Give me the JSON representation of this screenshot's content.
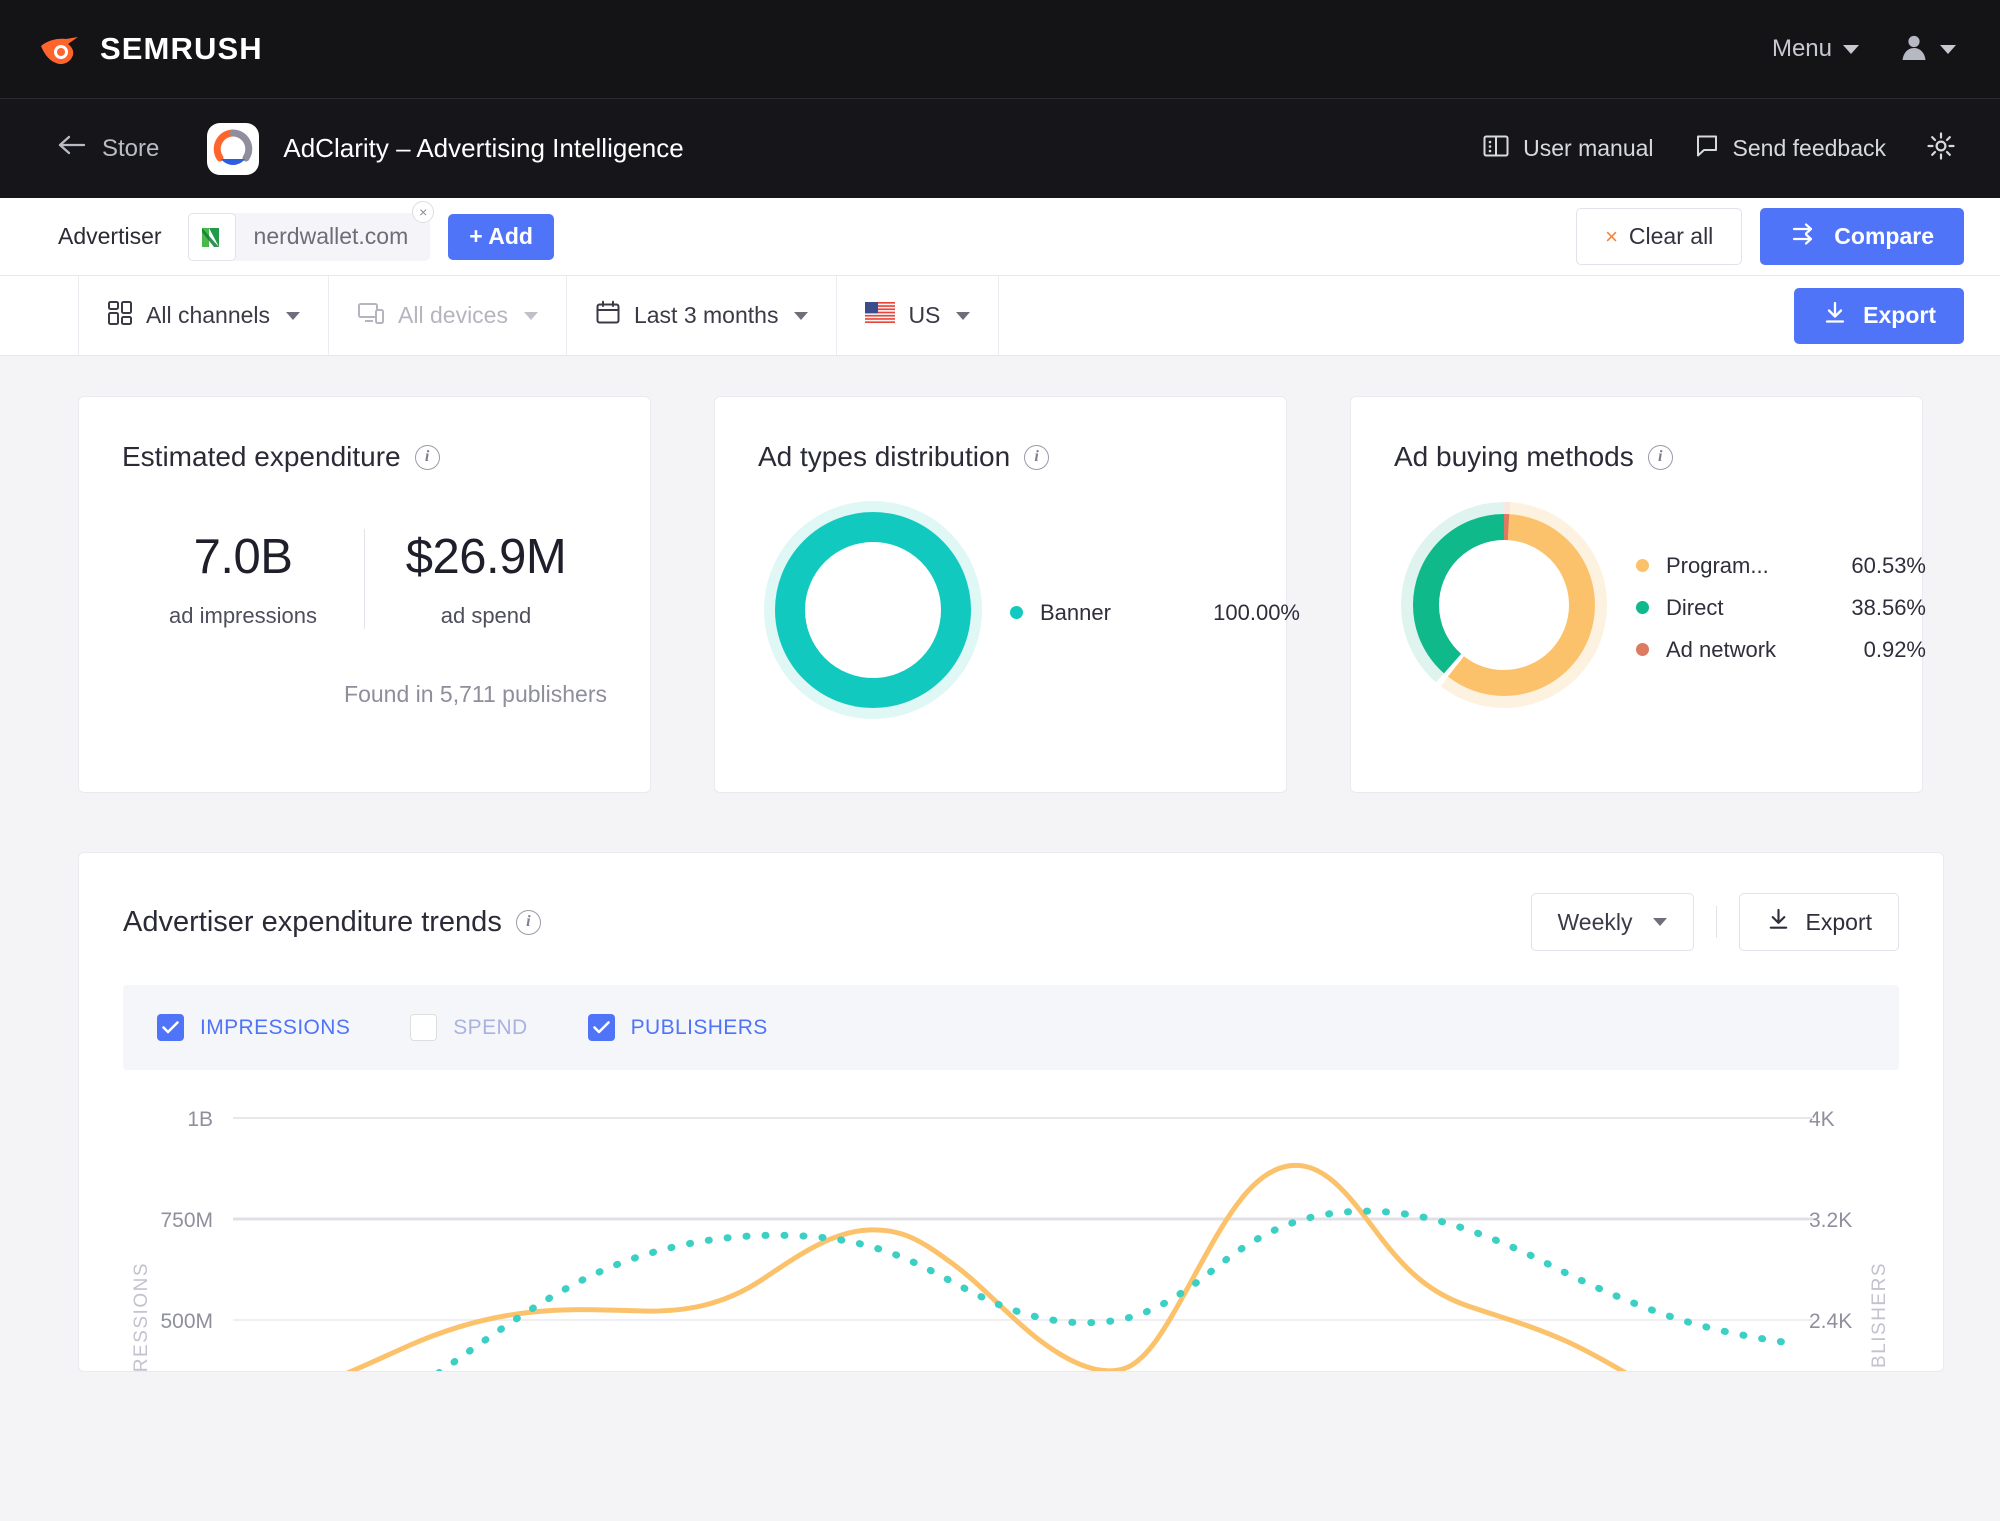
{
  "brand": {
    "name": "SEMRUSH",
    "logo_icon": "semrush-flame-icon",
    "accent": "#ff642d"
  },
  "topbar": {
    "menu_label": "Menu",
    "menu_caret_icon": "chevron-down-icon",
    "user_icon": "user-avatar-icon",
    "user_caret_icon": "chevron-down-icon"
  },
  "appbar": {
    "back_icon": "arrow-left-icon",
    "store_label": "Store",
    "app_icon": "adclarity-app-icon",
    "app_title": "AdClarity – Advertising Intelligence",
    "user_manual_icon": "book-icon",
    "user_manual_label": "User manual",
    "feedback_icon": "speech-bubble-icon",
    "feedback_label": "Send feedback",
    "settings_icon": "gear-icon"
  },
  "advertiser_bar": {
    "label": "Advertiser",
    "chip": {
      "icon": "nerdwallet-logo-icon",
      "value": "nerdwallet.com",
      "remove_icon": "close-icon"
    },
    "add_label": "+ Add",
    "clear_all_label": "Clear all",
    "clear_all_icon": "close-icon",
    "compare_label": "Compare",
    "compare_icon": "compare-arrows-icon"
  },
  "filters": {
    "items": [
      {
        "icon": "grid-icon",
        "label": "All channels",
        "disabled": false
      },
      {
        "icon": "devices-icon",
        "label": "All devices",
        "disabled": true
      },
      {
        "icon": "calendar-icon",
        "label": "Last 3 months",
        "disabled": false
      },
      {
        "icon": "us-flag-icon",
        "label": "US",
        "disabled": false
      }
    ],
    "export_label": "Export",
    "export_icon": "download-icon"
  },
  "cards": {
    "expenditure": {
      "title": "Estimated expenditure",
      "info_icon": "info-icon",
      "impressions_value": "7.0B",
      "impressions_label": "ad impressions",
      "spend_value": "$26.9M",
      "spend_label": "ad spend",
      "found_text": "Found in 5,711 publishers"
    },
    "ad_types": {
      "title": "Ad types distribution",
      "info_icon": "info-icon"
    },
    "ad_buying": {
      "title": "Ad buying methods",
      "info_icon": "info-icon"
    }
  },
  "trends": {
    "title": "Advertiser expenditure trends",
    "info_icon": "info-icon",
    "granularity_label": "Weekly",
    "granularity_caret_icon": "chevron-down-icon",
    "export_label": "Export",
    "export_icon": "download-icon",
    "series_toggles": [
      {
        "label": "IMPRESSIONS",
        "checked": true
      },
      {
        "label": "SPEND",
        "checked": false
      },
      {
        "label": "PUBLISHERS",
        "checked": true
      }
    ]
  },
  "chart_data": [
    {
      "type": "pie",
      "title": "Ad types distribution",
      "legend_position": "right",
      "categories": [
        "Banner"
      ],
      "values": [
        100.0
      ],
      "value_labels": [
        "100.00%"
      ],
      "colors": [
        "#12c9bf"
      ],
      "track_colors": [
        "#dff7f5"
      ]
    },
    {
      "type": "pie",
      "title": "Ad buying methods",
      "legend_position": "right",
      "categories": [
        "Program...",
        "Direct",
        "Ad network"
      ],
      "values": [
        60.53,
        38.56,
        0.92
      ],
      "value_labels": [
        "60.53%",
        "38.56%",
        "0.92%"
      ],
      "colors": [
        "#fbc26b",
        "#0fb98a",
        "#dd7a62"
      ],
      "track_colors": [
        "#fdf2e0",
        "#dff4ee",
        "#f8e6e1"
      ]
    },
    {
      "type": "line",
      "title": "Advertiser expenditure trends",
      "xlabel": "",
      "ylabel": "IMPRESSIONS",
      "y2label": "PUBLISHERS",
      "yticks": [
        "1B",
        "750M",
        "500M"
      ],
      "ytick_values": [
        1000000000,
        750000000,
        500000000
      ],
      "y2ticks": [
        "4K",
        "3.2K",
        "2.4K"
      ],
      "y2tick_values": [
        4000,
        3200,
        2400
      ],
      "grid": true,
      "series": [
        {
          "name": "IMPRESSIONS",
          "color": "#fbc26b",
          "style": "solid",
          "axis": "left",
          "values": [
            120000000,
            170000000,
            290000000,
            430000000,
            490000000,
            505000000,
            508000000,
            506000000,
            512000000,
            600000000,
            710000000,
            728000000,
            726000000,
            700000000,
            560000000,
            420000000,
            300000000,
            260000000,
            420000000,
            760000000,
            935000000,
            870000000,
            720000000,
            640000000,
            560000000,
            430000000,
            320000000
          ]
        },
        {
          "name": "PUBLISHERS",
          "color": "#3ccfc4",
          "style": "dotted",
          "axis": "right",
          "values": [
            2050,
            2180,
            2330,
            2520,
            2690,
            2830,
            2930,
            2990,
            3010,
            2985,
            2930,
            2840,
            2740,
            2650,
            2590,
            2560,
            2560,
            2600,
            2720,
            2870,
            2990,
            3030,
            3030,
            2985,
            2900,
            2800,
            2680,
            2590
          ]
        }
      ]
    }
  ]
}
